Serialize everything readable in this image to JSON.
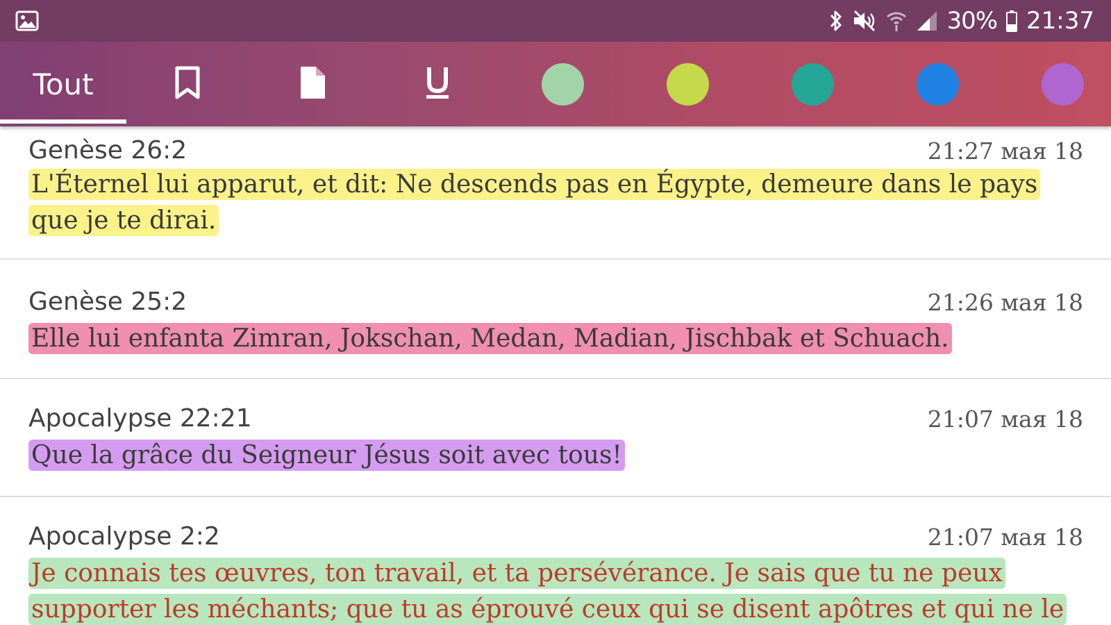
{
  "status_bar": {
    "battery_percent": "30%",
    "time": "21:37",
    "icons": [
      "gallery-icon",
      "bluetooth-icon",
      "mute-icon",
      "wifi-icon",
      "signal-icon",
      "battery-icon"
    ]
  },
  "tabs": {
    "all_label": "Tout",
    "icons": [
      "bookmark-icon",
      "note-icon",
      "underline-icon"
    ],
    "colors": [
      "#a3d3a9",
      "#c3d94a",
      "#25a696",
      "#1f82e2",
      "#b066d0"
    ]
  },
  "highlight_colors": {
    "yellow": "#fbf28a",
    "pink": "#f18fb0",
    "purple": "#d49cf0",
    "green": "#b8e6bd"
  },
  "items": [
    {
      "reference": "Genèse 26:2",
      "date": "21:27 мая 18",
      "text": "L'Éternel lui apparut, et dit: Ne descends pas en Égypte, demeure dans le pays que je te dirai.",
      "highlight": "yellow",
      "text_color": "#3a3a3a"
    },
    {
      "reference": "Genèse 25:2",
      "date": "21:26 мая 18",
      "text": "Elle lui enfanta Zimran, Jokschan, Medan, Madian, Jischbak et Schuach.",
      "highlight": "pink",
      "text_color": "#3a3a3a"
    },
    {
      "reference": "Apocalypse 22:21",
      "date": "21:07 мая 18",
      "text": "Que la grâce du Seigneur Jésus soit avec tous!",
      "highlight": "purple",
      "text_color": "#3a3a3a"
    },
    {
      "reference": "Apocalypse 2:2",
      "date": "21:07 мая 18",
      "text": "Je connais tes œuvres, ton travail, et ta persévérance. Je sais que tu ne peux supporter les méchants; que tu as éprouvé ceux qui se disent apôtres et qui ne le",
      "highlight": "green",
      "text_color": "#c0392b"
    }
  ]
}
